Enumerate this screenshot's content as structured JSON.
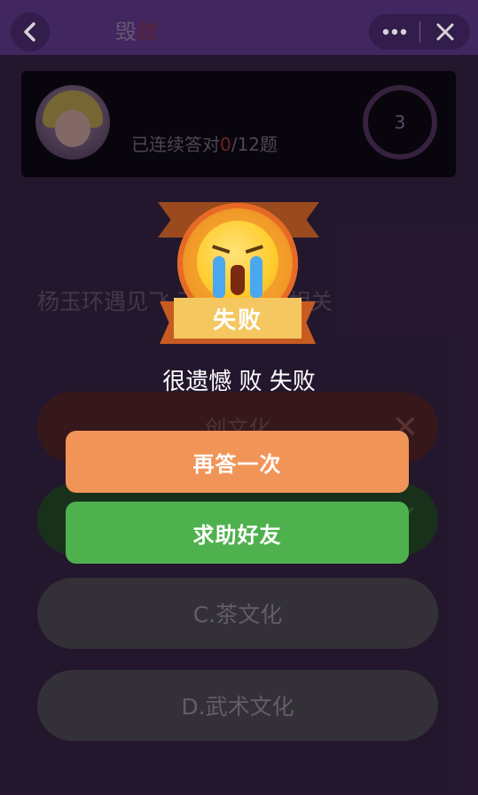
{
  "colors": {
    "nav_bg": "#4c2d6e",
    "retry_button": "#f19457",
    "help_button": "#4fb14e",
    "fail_banner": "#f5c760"
  },
  "nav": {
    "back_icon": "chevron-left-icon",
    "more_icon": "more-dots-icon",
    "close_icon": "close-icon"
  },
  "player": {
    "name_prefix": "毁",
    "name_accent": "啟",
    "streak_prefix": "已连续答对",
    "streak_count": "0",
    "streak_suffix": "/12题",
    "timer": "3"
  },
  "quiz": {
    "question": "杨玉环遇见飞 下哪种文化相关",
    "options": [
      {
        "label": "创文化",
        "state": "wrong"
      },
      {
        "label": "",
        "state": "correct"
      },
      {
        "label": "C.茶文化",
        "state": "normal"
      },
      {
        "label": "D.武术文化",
        "state": "normal"
      }
    ]
  },
  "modal": {
    "badge_label": "失败",
    "message": "很遗憾 败 失败",
    "retry_label": "再答一次",
    "help_label": "求助好友"
  }
}
